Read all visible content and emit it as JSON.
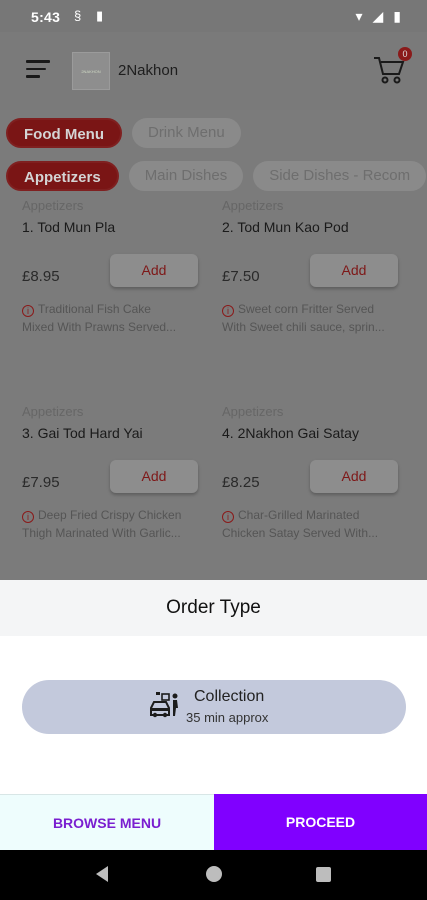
{
  "status": {
    "time": "5:43"
  },
  "header": {
    "brand": "2Nakhon",
    "logo_text": "2NAKHON",
    "cart_count": "0"
  },
  "tabs_top": [
    {
      "label": "Food Menu",
      "active": true
    },
    {
      "label": "Drink Menu",
      "active": false
    }
  ],
  "tabs_sub": [
    {
      "label": "Appetizers",
      "active": true
    },
    {
      "label": "Main Dishes",
      "active": false
    },
    {
      "label": "Side Dishes - Recom",
      "active": false
    }
  ],
  "items": [
    {
      "category": "Appetizers",
      "name": "1. Tod Mun Pla",
      "price": "£8.95",
      "add_label": "Add",
      "desc1": "Traditional Fish Cake",
      "desc2": "Mixed With Prawns Served..."
    },
    {
      "category": "Appetizers",
      "name": "2. Tod Mun Kao Pod",
      "price": "£7.50",
      "add_label": "Add",
      "desc1": "Sweet corn Fritter Served",
      "desc2": "With Sweet chili sauce, sprin..."
    },
    {
      "category": "Appetizers",
      "name": "3. Gai Tod Hard Yai",
      "price": "£7.95",
      "add_label": "Add",
      "desc1": "Deep Fried Crispy Chicken",
      "desc2": "Thigh Marinated With Garlic..."
    },
    {
      "category": "Appetizers",
      "name": "4. 2Nakhon Gai Satay",
      "price": "£8.25",
      "add_label": "Add",
      "desc1": "Char-Grilled Marinated",
      "desc2": "Chicken Satay Served With..."
    }
  ],
  "sheet": {
    "title": "Order Type",
    "option": {
      "title": "Collection",
      "subtitle": "35 min approx"
    },
    "browse_label": "BROWSE MENU",
    "proceed_label": "PROCEED"
  },
  "colors": {
    "accent": "#8000ff",
    "brand_red": "#b22222",
    "option_bg": "#c3c9dc"
  }
}
